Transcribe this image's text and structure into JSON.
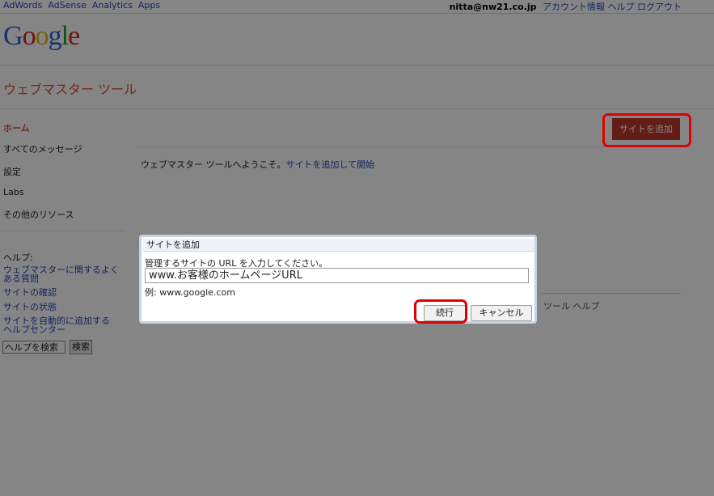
{
  "topbar": {
    "links": [
      "AdWords",
      "AdSense",
      "Analytics",
      "Apps"
    ],
    "user_email": "nitta@nw21.co.jp",
    "right_links": [
      "アカウント情報",
      "ヘルプ",
      "ログアウト"
    ]
  },
  "logo": {
    "letters": [
      "G",
      "o",
      "o",
      "g",
      "l",
      "e"
    ]
  },
  "app_title": "ウェブマスター ツール",
  "sidebar": {
    "items": [
      {
        "label": "ホーム"
      },
      {
        "label": "すべてのメッセージ"
      },
      {
        "label": "設定"
      },
      {
        "label": "Labs"
      },
      {
        "label": "その他のリソース"
      }
    ],
    "help_title": "ヘルプ:",
    "help_links": [
      {
        "label": "ウェブマスターに関するよく\nある質問"
      },
      {
        "label": "サイトの確認"
      },
      {
        "label": "サイトの状態"
      },
      {
        "label": "サイトを自動的に追加する\nヘルプセンター"
      }
    ],
    "help_search_value": "ヘルプを検索",
    "help_search_button": "検索"
  },
  "main": {
    "add_site_button": "サイトを追加",
    "welcome_text": "ウェブマスター ツールへようこそ。",
    "welcome_link": "サイトを追加して開始",
    "footer_help": "ツール ヘルプ"
  },
  "dialog": {
    "title": "サイトを追加",
    "prompt": "管理するサイトの URL を入力してください。",
    "input_value": "www.お客様のホームページURL",
    "example": "例: www.google.com",
    "continue_button": "続行",
    "cancel_button": "キャンセル"
  },
  "colors": {
    "highlight": "#e00000",
    "accent": "#dd4b39",
    "link": "#2a48b8",
    "overlay": "rgba(0,0,0,0.48)"
  }
}
